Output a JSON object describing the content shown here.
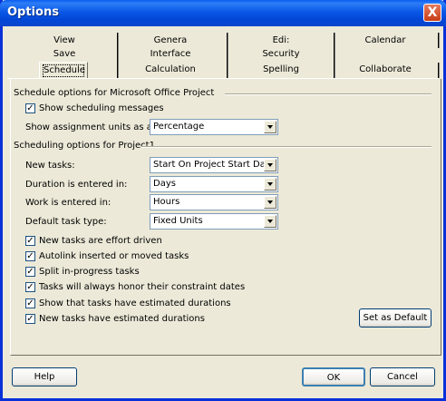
{
  "window": {
    "title": "Options",
    "close_label": "X"
  },
  "tabs": {
    "row1": [
      "View",
      "Genera",
      "Edi:",
      "Calendar"
    ],
    "row2": [
      "Save",
      "Interface",
      "Security"
    ],
    "row3": [
      "Schedule",
      "Calculation",
      "Spelling",
      "Collaborate"
    ]
  },
  "section1": {
    "title": "Schedule options for Microsoft Office Project",
    "show_messages": {
      "label": "Show scheduling messages",
      "checked": true
    },
    "assign_units": {
      "label": "Show assignment units as a:",
      "value": "Percentage"
    }
  },
  "section2": {
    "title": "Scheduling options for Project1",
    "fields": [
      {
        "label": "New tasks:",
        "value": "Start On Project Start Date"
      },
      {
        "label": "Duration is entered in:",
        "value": "Days"
      },
      {
        "label": "Work is entered in:",
        "value": "Hours"
      },
      {
        "label": "Default task type:",
        "value": "Fixed Units"
      }
    ],
    "checkboxes": [
      {
        "label": "New tasks are effort driven",
        "checked": true
      },
      {
        "label": "Autolink inserted or moved tasks",
        "checked": true
      },
      {
        "label": "Split in-progress tasks",
        "checked": true
      },
      {
        "label": "Tasks will always honor their constraint dates",
        "checked": true
      },
      {
        "label": "Show that tasks have estimated durations",
        "checked": true
      },
      {
        "label": "New tasks have estimated durations",
        "checked": true
      }
    ],
    "set_default_label": "Set as Default"
  },
  "buttons": {
    "help": "Help",
    "ok": "OK",
    "cancel": "Cancel"
  },
  "check_glyph": "✓"
}
